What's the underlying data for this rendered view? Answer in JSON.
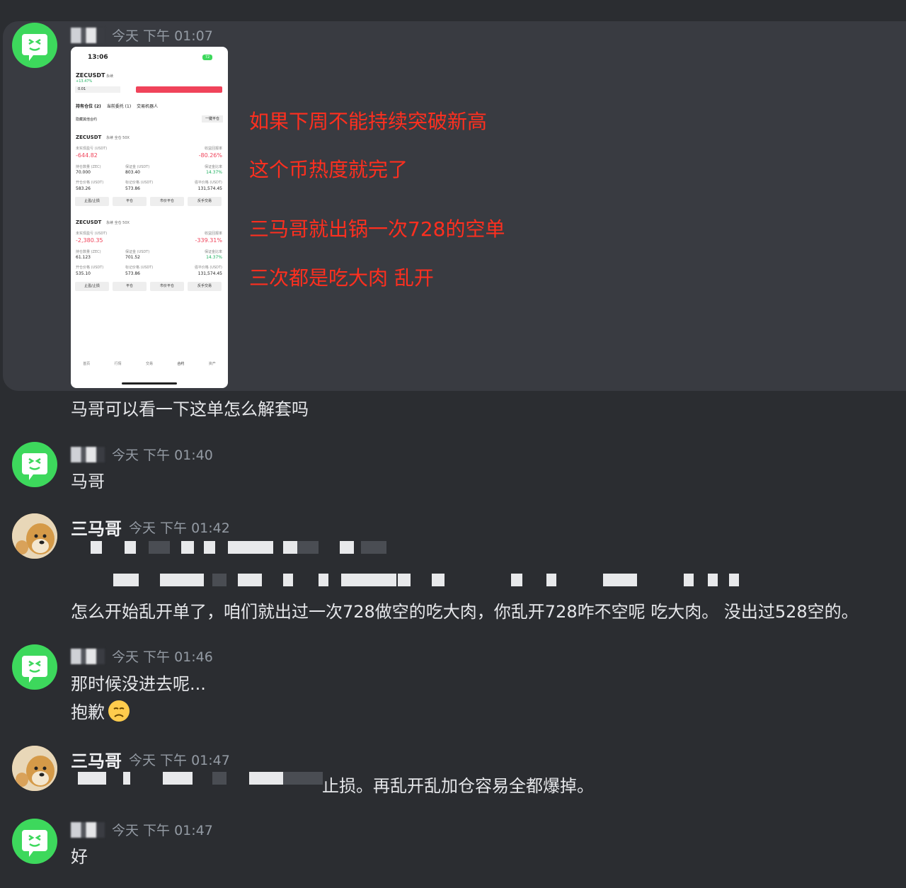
{
  "messages": [
    {
      "time": "今天 下午 01:07",
      "annotations": [
        "如果下周不能持续突破新高",
        "这个币热度就完了",
        "三马哥就出锅一次728的空单",
        "三次都是吃大肉 乱开"
      ],
      "text": "马哥可以看一下这单怎么解套吗"
    },
    {
      "time": "今天 下午 01:40",
      "text": "马哥"
    },
    {
      "name": "三马哥",
      "time": "今天 下午 01:42",
      "text": "怎么开始乱开单了，咱们就出过一次728做空的吃大肉，你乱开728咋不空呢 吃大肉。 没出过528空的。"
    },
    {
      "time": "今天 下午 01:46",
      "text": "那时候没进去呢...",
      "text2": "抱歉"
    },
    {
      "name": "三马哥",
      "time": "今天 下午 01:47",
      "text": "止损。再乱开乱加仓容易全都爆掉。"
    },
    {
      "time": "今天 下午 01:47",
      "text": "好"
    }
  ],
  "screenshot": {
    "status_time": "13:06",
    "battery": "72",
    "symbol": "ZECUSDT",
    "perp": "永续",
    "change": "+13.47%",
    "qty": "0.01",
    "tabs": [
      "持有仓位 (2)",
      "当前委托 (1)",
      "交易机器人"
    ],
    "hide_other": "隐藏其他合约",
    "close_all": "一键平仓",
    "positions": [
      {
        "symbol": "ZECUSDT",
        "tags": "永续  全仓 50X",
        "pnl_label": "未实现盈亏 (USDT)",
        "pnl": "-644.82",
        "roe_label": "收益回报率",
        "roe": "-80.26%",
        "size_label": "持仓数量 (ZEC)",
        "size": "70.000",
        "margin_label": "保证金 (USDT)",
        "margin": "803.40",
        "mr_label": "保证金比率",
        "mr": "14.37%",
        "entry_label": "开仓价格 (USDT)",
        "entry": "583.26",
        "mark_label": "标记价格 (USDT)",
        "mark": "573.86",
        "liq_label": "强平价格 (USDT)",
        "liq": "131,574.45"
      },
      {
        "symbol": "ZECUSDT",
        "tags": "永续  全仓 50X",
        "pnl_label": "未实现盈亏 (USDT)",
        "pnl": "-2,380.35",
        "roe_label": "收益回报率",
        "roe": "-339.31%",
        "size_label": "持仓数量 (ZEC)",
        "size": "61.123",
        "margin_label": "保证金 (USDT)",
        "margin": "701.52",
        "mr_label": "保证金比率",
        "mr": "14.37%",
        "entry_label": "开仓价格 (USDT)",
        "entry": "535.10",
        "mark_label": "标记价格 (USDT)",
        "mark": "573.86",
        "liq_label": "强平价格 (USDT)",
        "liq": "131,574.45"
      }
    ],
    "buttons": [
      "止盈/止损",
      "平仓",
      "市价平仓",
      "反手交易"
    ],
    "nav": [
      "首页",
      "行情",
      "交易",
      "合约",
      "资产"
    ]
  },
  "colors": {
    "background": "#2b2d31",
    "highlight": "#393b41",
    "annotation": "#ff2f1f",
    "avatar_green": "#3dd85c"
  }
}
